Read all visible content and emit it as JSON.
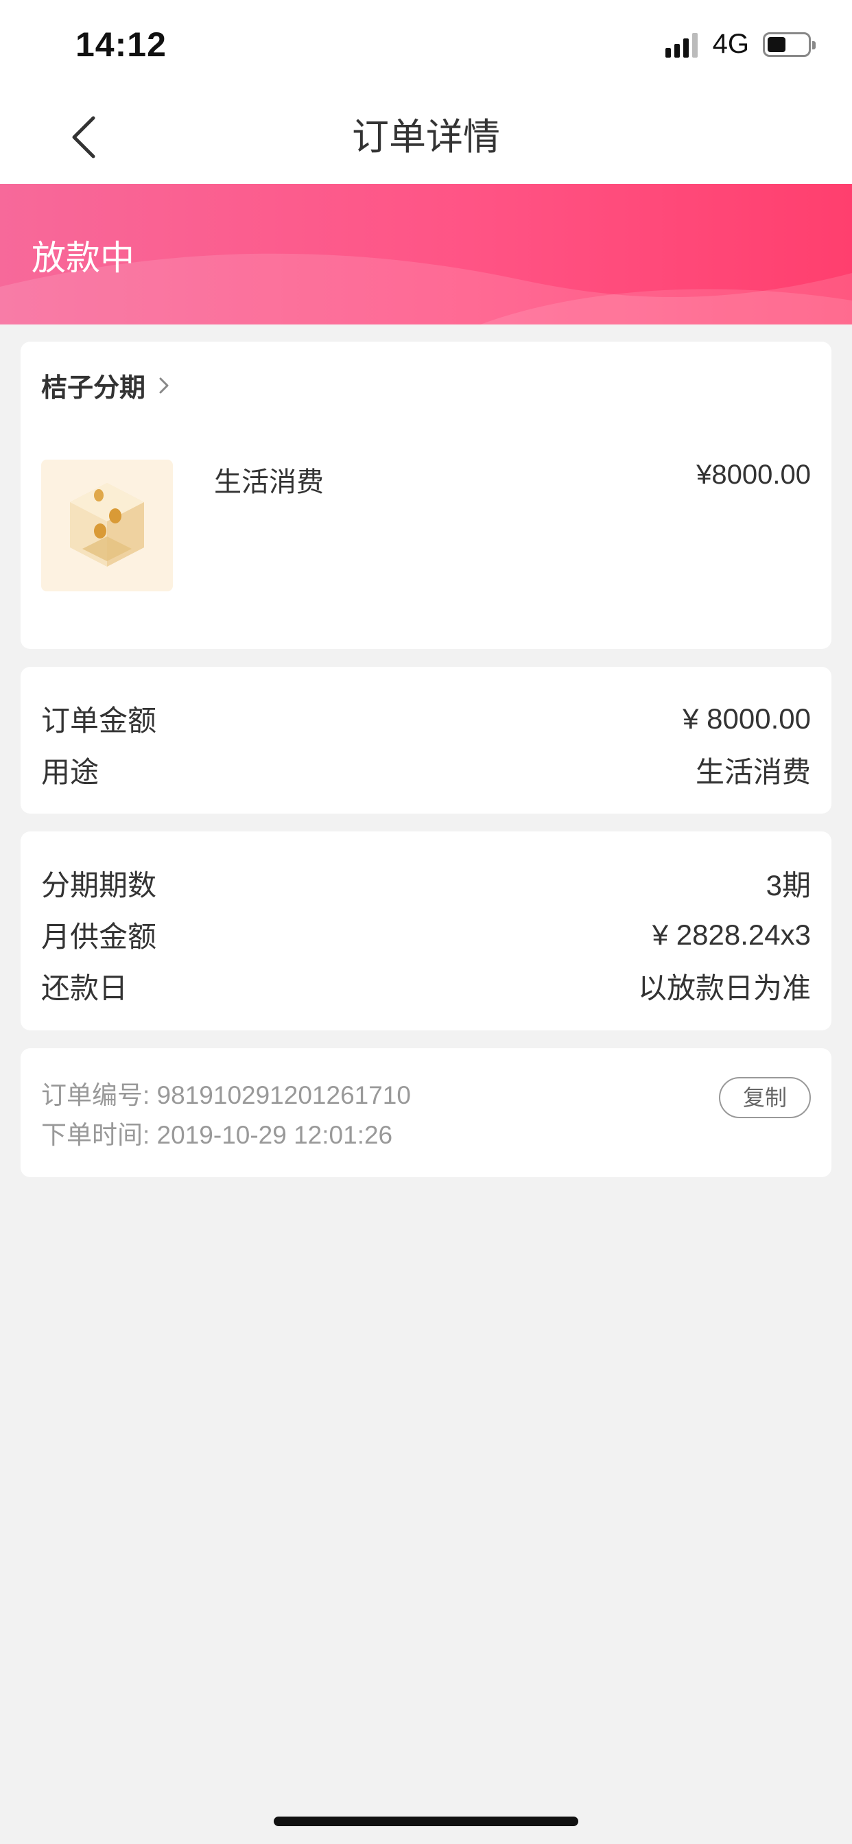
{
  "status_bar": {
    "time": "14:12",
    "network": "4G"
  },
  "nav": {
    "title": "订单详情"
  },
  "banner": {
    "status": "放款中"
  },
  "product": {
    "merchant": "桔子分期",
    "name": "生活消费",
    "price": "¥8000.00"
  },
  "amount": {
    "rows": [
      {
        "label": "订单金额",
        "value": "¥ 8000.00"
      },
      {
        "label": "用途",
        "value": "生活消费"
      }
    ]
  },
  "installment": {
    "rows": [
      {
        "label": "分期期数",
        "value": "3期"
      },
      {
        "label": "月供金额",
        "value": "¥ 2828.24x3"
      },
      {
        "label": "还款日",
        "value": "以放款日为准"
      }
    ]
  },
  "order": {
    "number_line": "订单编号: 981910291201261710",
    "time_line": "下单时间: 2019-10-29 12:01:26",
    "copy_label": "复制"
  },
  "colors": {
    "banner_start": "#f7699a",
    "banner_end": "#ff3f6e",
    "background": "#f2f2f2"
  },
  "icons": [
    "signal-icon",
    "battery-icon",
    "back-arrow-icon",
    "chevron-right-icon",
    "product-coins-icon"
  ]
}
